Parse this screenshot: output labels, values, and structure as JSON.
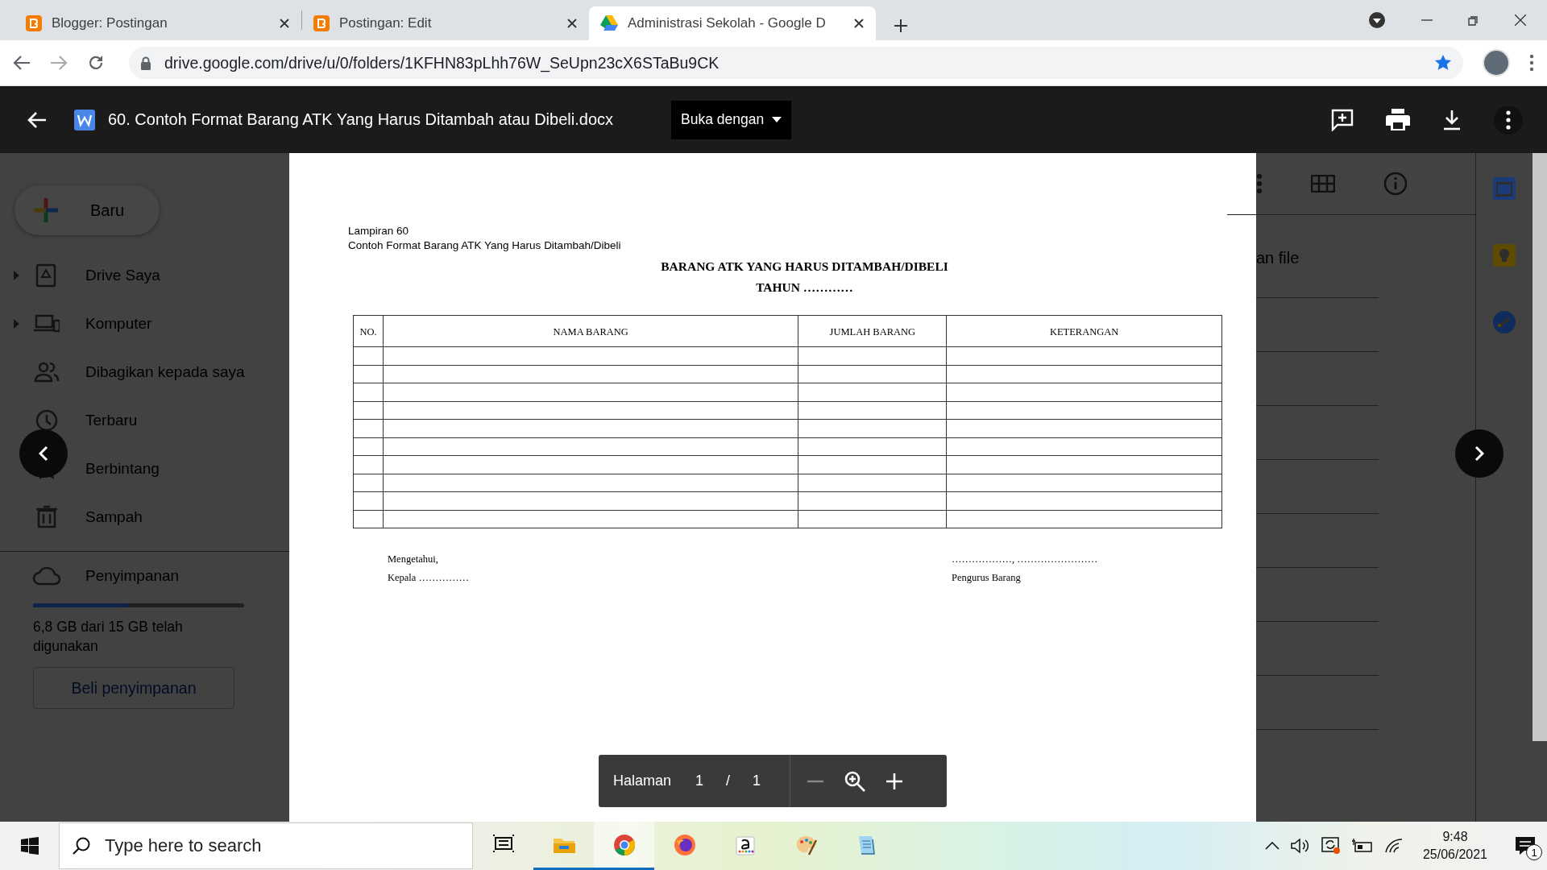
{
  "browser": {
    "tabs": [
      {
        "title": "Blogger: Postingan",
        "kind": "blogger",
        "selected": false
      },
      {
        "title": "Postingan: Edit",
        "kind": "blogger",
        "selected": false
      },
      {
        "title": "Administrasi Sekolah - Google D",
        "kind": "drive",
        "selected": true
      }
    ],
    "url": "drive.google.com/drive/u/0/folders/1KFHN83pLhh76W_SeUpn23cX6STaBu9CK"
  },
  "viewer": {
    "file_name": "60. Contoh Format Barang ATK Yang Harus Ditambah atau Dibeli.docx",
    "open_with": "Buka dengan",
    "pager": {
      "label": "Halaman",
      "current": "1",
      "separator": "/",
      "total": "1"
    }
  },
  "drive": {
    "new_button": "Baru",
    "nav": [
      {
        "label": "Drive Saya",
        "kind": "drive",
        "expandable": true
      },
      {
        "label": "Komputer",
        "kind": "computer",
        "expandable": true
      },
      {
        "label": "Dibagikan kepada saya",
        "kind": "shared",
        "expandable": false
      },
      {
        "label": "Terbaru",
        "kind": "recent",
        "expandable": false
      },
      {
        "label": "Berbintang",
        "kind": "starred",
        "expandable": false
      },
      {
        "label": "Sampah",
        "kind": "trash",
        "expandable": false
      }
    ],
    "storage": {
      "label": "Penyimpanan",
      "level": 0.45,
      "usage": "6,8 GB dari 15 GB telah digunakan",
      "buy": "Beli penyimpanan"
    },
    "list_heading": "an file"
  },
  "document": {
    "lines": [
      "Lampiran 60",
      "Contoh Format Barang ATK Yang Harus Ditambah/Dibeli"
    ],
    "title": "BARANG ATK YANG HARUS DITAMBAH/DIBELI",
    "subtitle": "TAHUN …………",
    "table": {
      "columns": [
        "NO.",
        "NAMA BARANG",
        "JUMLAH BARANG",
        "KETERANGAN"
      ],
      "rows": [
        {
          "kind": "blank"
        },
        {
          "kind": "blank"
        },
        {
          "kind": "blank"
        },
        {
          "kind": "blank"
        },
        {
          "kind": "blank"
        },
        {
          "kind": "blank"
        },
        {
          "kind": "blank"
        },
        {
          "kind": "blank"
        },
        {
          "kind": "blank"
        },
        {
          "kind": "blank"
        }
      ]
    },
    "signatures": {
      "left": [
        "Mengetahui,",
        "Kepala ……………"
      ],
      "right": [
        "………………, ……………………",
        "Pengurus Barang"
      ]
    }
  },
  "taskbar": {
    "search_placeholder": "Type here to search",
    "apps": [
      {
        "kind": "task-view",
        "running": false,
        "selected": false
      },
      {
        "kind": "file-explorer",
        "running": true,
        "selected": false
      },
      {
        "kind": "chrome",
        "running": true,
        "selected": true
      },
      {
        "kind": "firefox",
        "running": false,
        "selected": false
      },
      {
        "kind": "amazon",
        "running": false,
        "selected": false
      },
      {
        "kind": "paint",
        "running": false,
        "selected": false
      },
      {
        "kind": "notepad",
        "running": false,
        "selected": false
      }
    ],
    "time": "9:48",
    "date": "25/06/2021",
    "notifications": "1"
  }
}
